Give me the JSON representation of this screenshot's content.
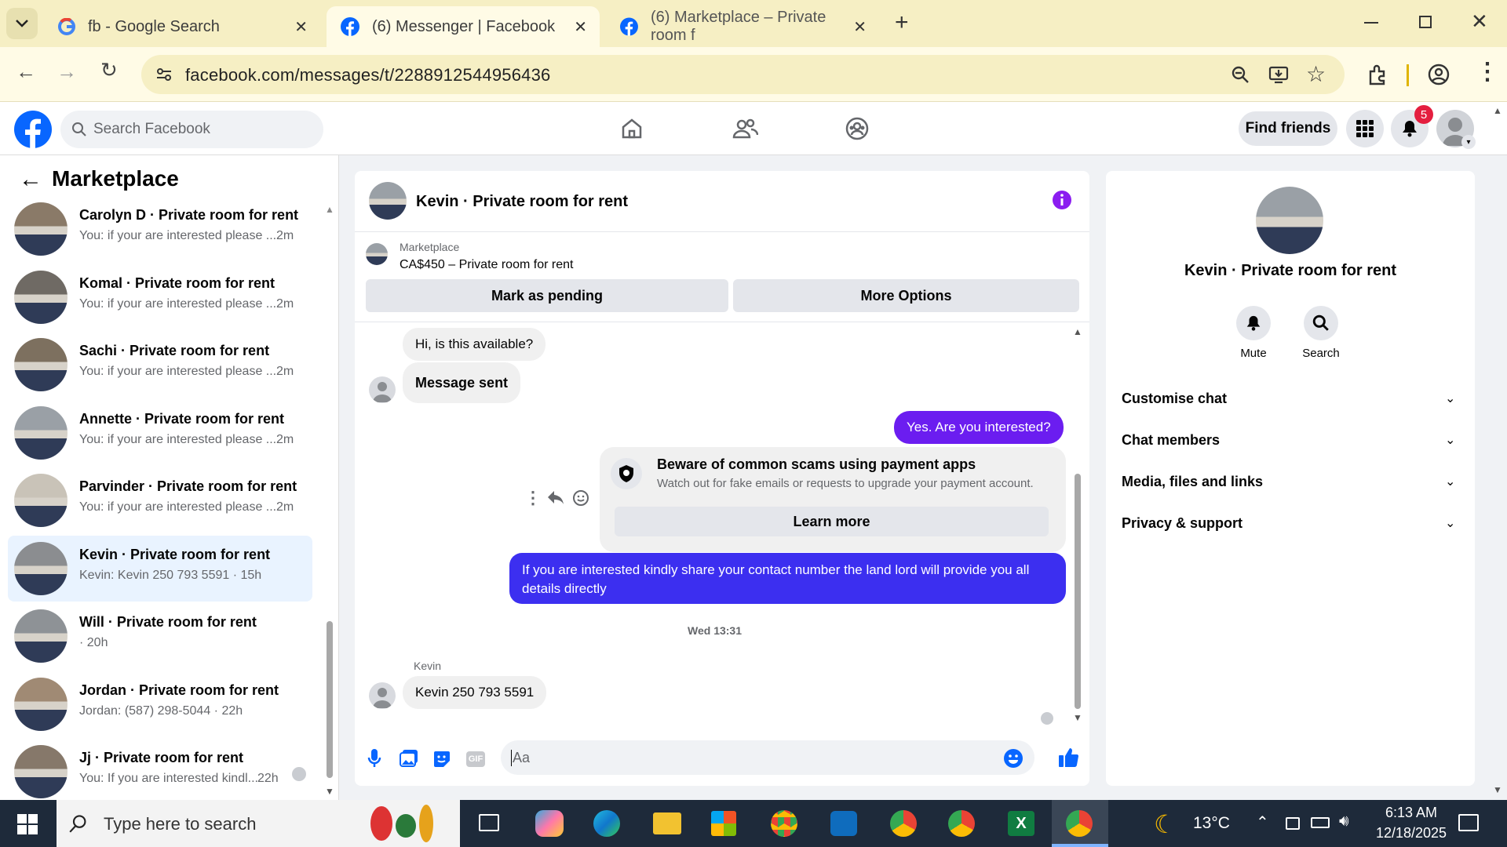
{
  "browser": {
    "tabs": [
      {
        "title": "fb - Google Search"
      },
      {
        "title": "(6) Messenger | Facebook"
      },
      {
        "title": "(6) Marketplace – Private room f"
      }
    ],
    "url": "facebook.com/messages/t/2288912544956436"
  },
  "fb_header": {
    "search_placeholder": "Search Facebook",
    "find_friends": "Find friends",
    "notification_count": "5"
  },
  "sidebar": {
    "title": "Marketplace",
    "conversations": [
      {
        "name": "Carolyn D · Private room for rent",
        "preview": "You: if your are interested please ...",
        "time": "2m"
      },
      {
        "name": "Komal · Private room for rent",
        "preview": "You: if your are interested please ...",
        "time": "2m"
      },
      {
        "name": "Sachi · Private room for rent",
        "preview": "You: if your are interested please ...",
        "time": "2m"
      },
      {
        "name": "Annette · Private room for rent",
        "preview": "You: if your are interested please ...",
        "time": "2m"
      },
      {
        "name": "Parvinder · Private room for rent",
        "preview": "You: if your are interested please ...",
        "time": "2m"
      },
      {
        "name": "Kevin · Private room for rent",
        "preview": "Kevin: Kevin 250 793 5591 · 15h",
        "time": ""
      },
      {
        "name": "Will · Private room for rent",
        "preview": "· 20h",
        "time": ""
      },
      {
        "name": "Jordan · Private room for rent",
        "preview": "Jordan: (587) 298-5044 · 22h",
        "time": ""
      },
      {
        "name": "Jj · Private room for rent",
        "preview": "You: If you are interested kindl...",
        "time": "22h"
      }
    ]
  },
  "chat": {
    "title": "Kevin · Private room for rent",
    "listing_label": "Marketplace",
    "listing_price": "CA$450 – Private room for rent",
    "mark_pending": "Mark as pending",
    "more_options": "More Options",
    "messages": {
      "m1": "Hi, is this available?",
      "m2": "Message sent",
      "m3": "Yes. Are you interested?",
      "scam_title": "Beware of common scams using payment apps",
      "scam_body": "Watch out for fake emails or requests to upgrade your payment account.",
      "learn_more": "Learn more",
      "m4": "If you are interested kindly share your contact number the land lord will provide you all details directly",
      "timestamp": "Wed 13:31",
      "sender": "Kevin",
      "m5": "Kevin 250 793 5591"
    },
    "composer_placeholder": "Aa"
  },
  "details": {
    "name": "Kevin · Private room for rent",
    "mute": "Mute",
    "search": "Search",
    "sections": [
      "Customise chat",
      "Chat members",
      "Media, files and links",
      "Privacy & support"
    ]
  },
  "taskbar": {
    "search_placeholder": "Type here to search",
    "weather": "13°C",
    "time": "6:13 AM",
    "date": "12/18/2025"
  },
  "colors": {
    "fb_blue": "#0866ff",
    "messenger_purple": "#6b1df0",
    "outgoing_blue": "#3c2ff0"
  }
}
